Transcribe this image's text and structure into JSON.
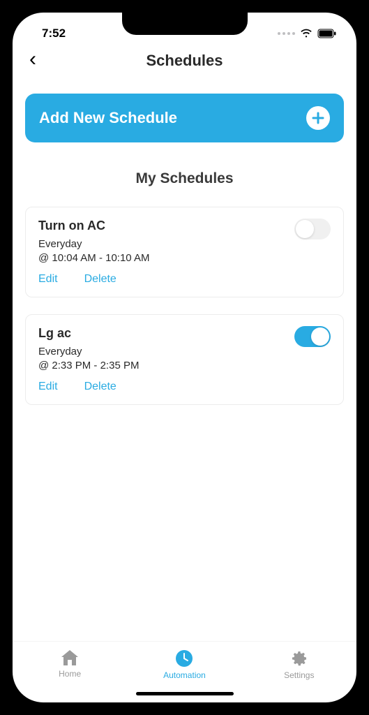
{
  "status": {
    "time": "7:52"
  },
  "nav": {
    "title": "Schedules"
  },
  "add_btn": {
    "label": "Add New Schedule"
  },
  "section": {
    "title": "My Schedules"
  },
  "schedules": [
    {
      "title": "Turn on AC",
      "repeat": "Everyday",
      "time": "@ 10:04 AM - 10:10 AM",
      "edit": "Edit",
      "delete": "Delete",
      "enabled": false
    },
    {
      "title": "Lg ac",
      "repeat": "Everyday",
      "time": "@ 2:33 PM - 2:35 PM",
      "edit": "Edit",
      "delete": "Delete",
      "enabled": true
    }
  ],
  "tabs": {
    "home": "Home",
    "automation": "Automation",
    "settings": "Settings"
  },
  "colors": {
    "accent": "#29abe2"
  }
}
